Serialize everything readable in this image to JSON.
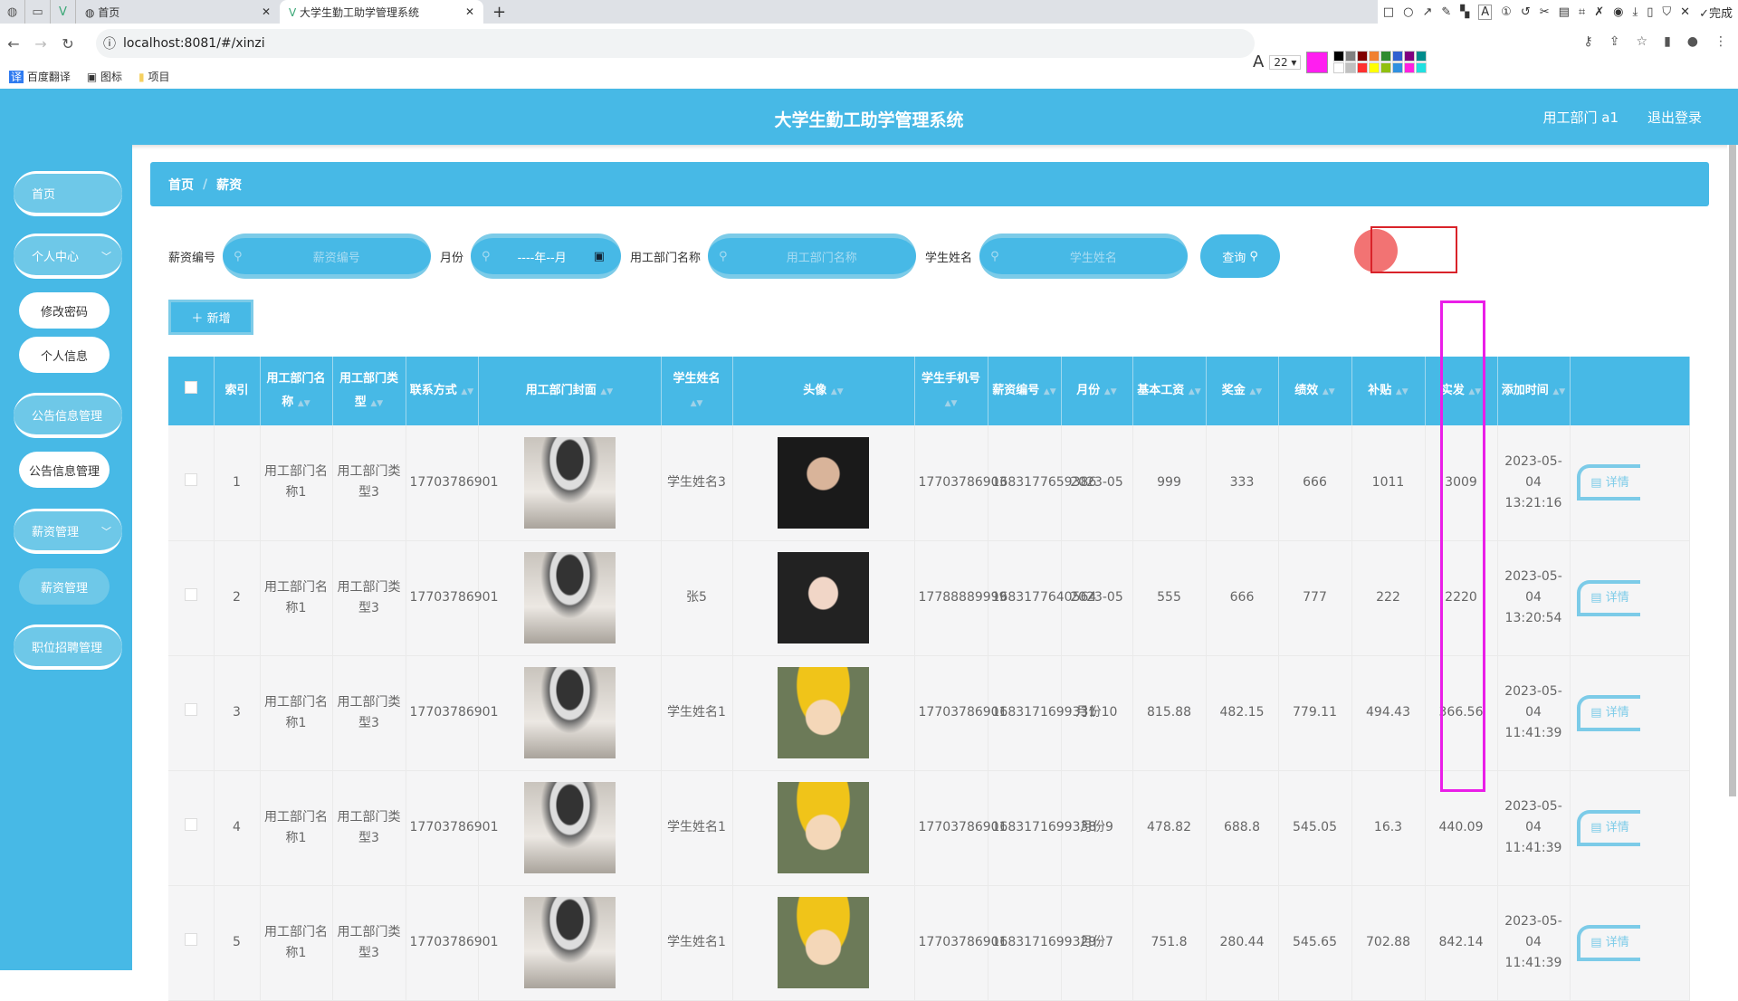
{
  "browser": {
    "tabs": [
      {
        "title": "首页"
      },
      {
        "title": "大学生勤工助学管理系统"
      }
    ],
    "url": "localhost:8081/#/xinzi",
    "bookmarks": [
      "百度翻译",
      "图标",
      "项目"
    ],
    "font_size": "22",
    "done_label": "完成",
    "colors": [
      "#ff1ef0",
      "#000000",
      "#808080",
      "#800000",
      "#f08030",
      "#2e8b2e",
      "#2f5fd0",
      "#800080",
      "#008b8b",
      "#ffffff",
      "#c0c0c0",
      "#ff3030",
      "#ffff00",
      "#90c010",
      "#3090e0",
      "#ff20e0",
      "#20e0e0"
    ]
  },
  "header": {
    "title": "大学生勤工助学管理系统",
    "user": "用工部门 a1",
    "logout": "退出登录"
  },
  "sidebar": {
    "items": [
      "首页",
      "个人中心",
      "修改密码",
      "个人信息",
      "公告信息管理",
      "公告信息管理",
      "薪资管理",
      "薪资管理",
      "职位招聘管理"
    ]
  },
  "breadcrumb": {
    "home": "首页",
    "sep": "/",
    "current": "薪资"
  },
  "search": {
    "f1_label": "薪资编号",
    "f1_ph": "薪资编号",
    "f2_label": "月份",
    "f2_ph": "----年--月",
    "f3_label": "用工部门名称",
    "f3_ph": "用工部门名称",
    "f4_label": "学生姓名",
    "f4_ph": "学生姓名",
    "query": "查询"
  },
  "add_label": "新增",
  "detail_label": "详情",
  "table": {
    "headers": [
      "索引",
      "用工部门名称",
      "用工部门类型",
      "联系方式",
      "用工部门封面",
      "学生姓名",
      "头像",
      "学生手机号",
      "薪资编号",
      "月份",
      "基本工资",
      "奖金",
      "绩效",
      "补贴",
      "实发",
      "添加时间"
    ],
    "rows": [
      [
        "1",
        "用工部门名称1",
        "用工部门类型3",
        "17703786901",
        "学生姓名3",
        "17703786903",
        "1683177659386",
        "2023-05",
        "999",
        "333",
        "666",
        "1011",
        "3009",
        "2023-05-04 13:21:16"
      ],
      [
        "2",
        "用工部门名称1",
        "用工部门类型3",
        "17703786901",
        "张5",
        "17788889999",
        "1683177640564",
        "2023-05",
        "555",
        "666",
        "777",
        "222",
        "2220",
        "2023-05-04 13:20:54"
      ],
      [
        "3",
        "用工部门名称1",
        "用工部门类型3",
        "17703786901",
        "学生姓名1",
        "17703786901",
        "1683171699331",
        "月份10",
        "815.88",
        "482.15",
        "779.11",
        "494.43",
        "366.56",
        "2023-05-04 11:41:39"
      ],
      [
        "4",
        "用工部门名称1",
        "用工部门类型3",
        "17703786901",
        "学生姓名1",
        "17703786901",
        "1683171699338",
        "月份9",
        "478.82",
        "688.8",
        "545.05",
        "16.3",
        "440.09",
        "2023-05-04 11:41:39"
      ],
      [
        "5",
        "用工部门名称1",
        "用工部门类型3",
        "17703786901",
        "学生姓名1",
        "17703786901",
        "1683171699329",
        "月份7",
        "751.8",
        "280.44",
        "545.65",
        "702.88",
        "842.14",
        "2023-05-04 11:41:39"
      ]
    ]
  }
}
